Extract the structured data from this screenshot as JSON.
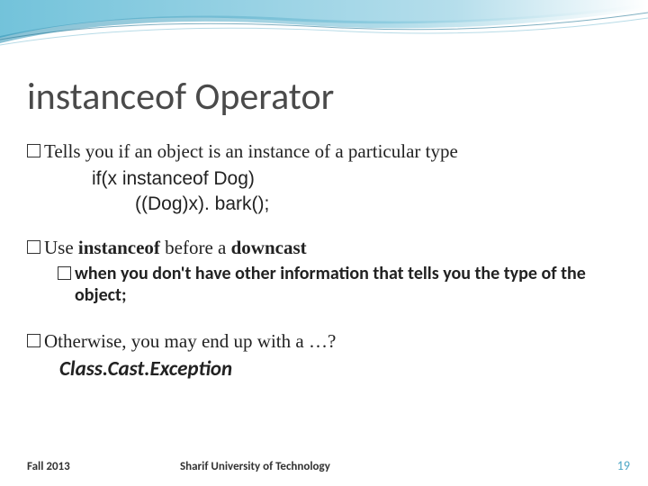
{
  "title": "instanceof Operator",
  "bullet1": "Tells you if an object is an instance of a particular type",
  "code_line1": "if(x instanceof Dog)",
  "code_line2": "((Dog)x). bark();",
  "bullet2_pre": "Use ",
  "bullet2_kw": "instanceof",
  "bullet2_mid": " before a ",
  "bullet2_end": "downcast",
  "bullet2_sub": "when you don't have other information that tells you the type of the object;",
  "bullet3": "Otherwise, you may end up with a …?",
  "exception": "Class.Cast.Exception",
  "footer_left": "Fall 2013",
  "footer_center": "Sharif University of Technology",
  "footer_right": "19"
}
